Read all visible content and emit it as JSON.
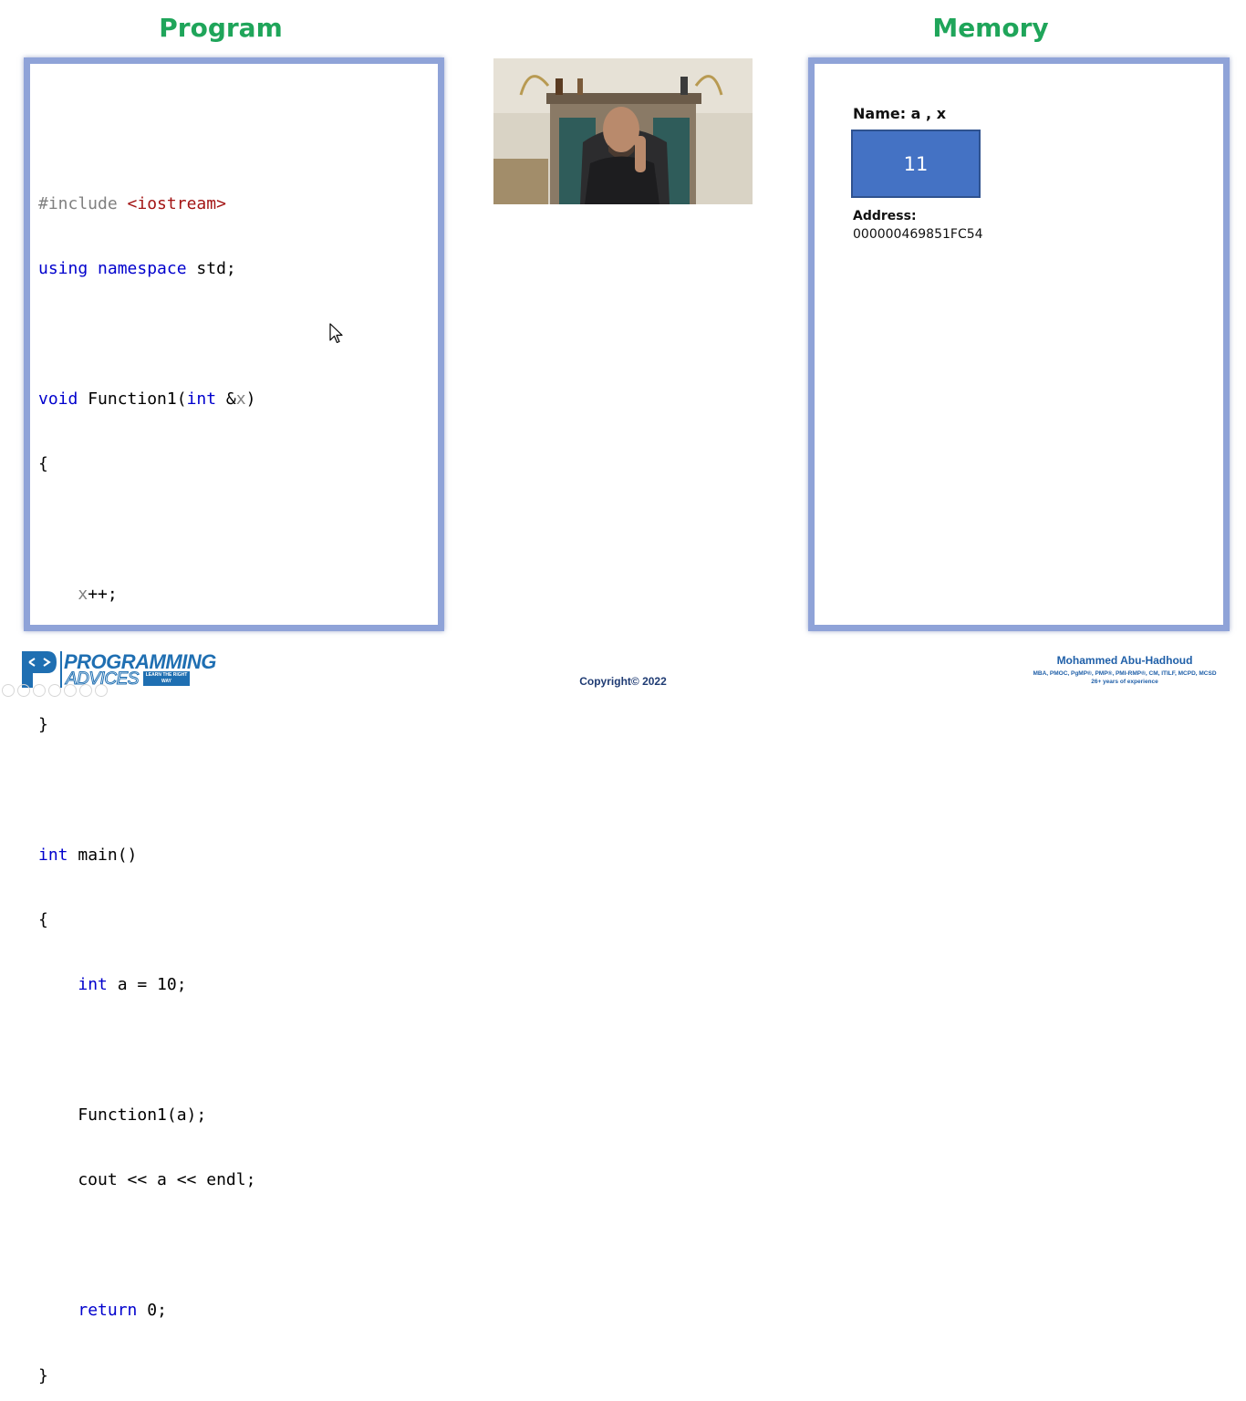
{
  "headings": {
    "program": "Program",
    "memory": "Memory"
  },
  "code": {
    "include_directive": "#include",
    "include_header": "<iostream>",
    "kw_using": "using",
    "kw_namespace": "namespace",
    "std_rest": " std;",
    "kw_void": "void",
    "func_decl_mid": " Function1(",
    "kw_int": "int",
    "amp": " &",
    "param_x": "x",
    "close_paren": ")",
    "open_brace": "{",
    "x_inc_indent": "    ",
    "x_inc_rest": "++;",
    "close_brace": "}",
    "main_rest": " main()",
    "indent": "    ",
    "int_a_rest": " a = 10;",
    "call_line": "    Function1(a);",
    "cout_line": "    cout << a << endl;",
    "kw_return": "return",
    "return_rest": " 0;"
  },
  "memory": {
    "name_label": "Name: a , x",
    "value": "11",
    "address_label": "Address:",
    "address_value": "000000469851FC54"
  },
  "brand": {
    "logo_line1": "PROGRAMMING",
    "logo_line2": "ADVICES",
    "logo_badge": "LEARN THE RIGHT WAY"
  },
  "footer": {
    "copyright": "Copyright© 2022",
    "author_name": "Mohammed Abu-Hadhoud",
    "author_certs": "MBA, PMOC, PgMP®, PMP®, PMI-RMP®, CM, ITILF, MCPD, MCSD",
    "author_experience": "26+ years of experience"
  },
  "colors": {
    "heading": "#1fa55a",
    "panel_border": "#8fa3d8",
    "keyword": "#0000cd",
    "string": "#a31515",
    "preprocessor": "#808080",
    "memory_box": "#4472c4",
    "brand": "#1f6fb2"
  },
  "icons": {
    "cursor": "mouse-pointer-icon",
    "logo": "programming-advices-logo-icon"
  }
}
